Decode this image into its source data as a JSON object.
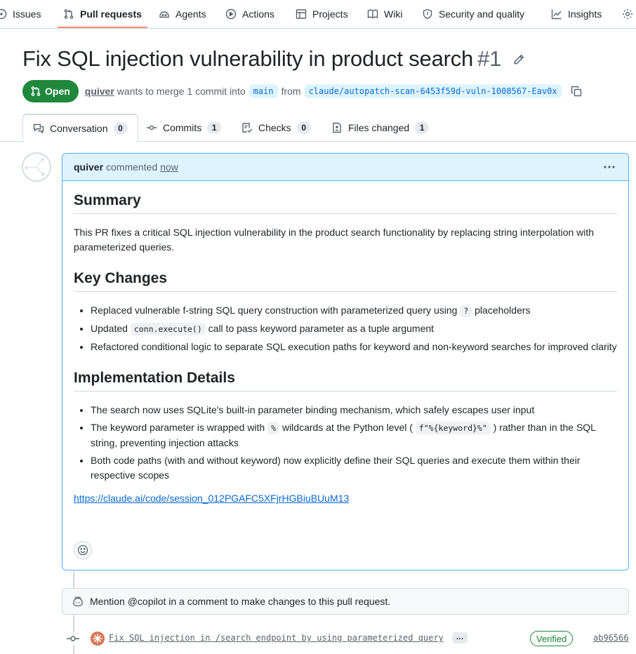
{
  "repo_nav": {
    "items": [
      {
        "label": "Issues",
        "icon": "issue-opened-icon"
      },
      {
        "label": "Pull requests",
        "icon": "git-pull-request-icon"
      },
      {
        "label": "Agents",
        "icon": "agents-icon"
      },
      {
        "label": "Actions",
        "icon": "play-icon"
      },
      {
        "label": "Projects",
        "icon": "table-icon"
      },
      {
        "label": "Wiki",
        "icon": "book-icon"
      },
      {
        "label": "Security and quality",
        "icon": "shield-icon"
      },
      {
        "label": "Insights",
        "icon": "graph-icon"
      }
    ],
    "active": "Pull requests",
    "accent_color": "#fd8c73"
  },
  "pr": {
    "title": "Fix SQL injection vulnerability in product search",
    "number": "#1",
    "state": "Open",
    "state_color": "#1f883d",
    "author": "quiver",
    "merge_text_1": "wants to merge 1 commit into",
    "base_branch": "main",
    "merge_text_2": "from",
    "head_branch": "claude/autopatch-scan-6453f59d-vuln-1008567-Eav0x"
  },
  "tabs": [
    {
      "label": "Conversation",
      "count": "0"
    },
    {
      "label": "Commits",
      "count": "1"
    },
    {
      "label": "Checks",
      "count": "0"
    },
    {
      "label": "Files changed",
      "count": "1"
    }
  ],
  "comment": {
    "author": "quiver",
    "action": "commented",
    "time": "now",
    "summary_heading": "Summary",
    "summary_text": "This PR fixes a critical SQL injection vulnerability in the product search functionality by replacing string interpolation with parameterized queries.",
    "key_changes_heading": "Key Changes",
    "key_changes": {
      "item1_pre": "Replaced vulnerable f-string SQL query construction with parameterized query using",
      "item1_code": "?",
      "item1_post": "placeholders",
      "item2_pre": "Updated",
      "item2_code": "conn.execute()",
      "item2_post": "call to pass keyword parameter as a tuple argument",
      "item3": "Refactored conditional logic to separate SQL execution paths for keyword and non-keyword searches for improved clarity"
    },
    "impl_heading": "Implementation Details",
    "impl": {
      "item1": "The search now uses SQLite's built-in parameter binding mechanism, which safely escapes user input",
      "item2_pre": "The keyword parameter is wrapped with",
      "item2_code1": "%",
      "item2_mid": "wildcards at the Python level (",
      "item2_code2": "f\"%{keyword}%\"",
      "item2_post": ") rather than in the SQL string, preventing injection attacks",
      "item3": "Both code paths (with and without keyword) now explicitly define their SQL queries and execute them within their respective scopes"
    },
    "link": "https://claude.ai/code/session_012PGAFC5XFjrHGBiuBUuM13"
  },
  "copilot_hint": "Mention @copilot in a comment to make changes to this pull request.",
  "commit": {
    "message": "Fix SQL injection in /search endpoint by using parameterized query",
    "more": "…",
    "verified": "Verified",
    "sha": "ab96566"
  }
}
